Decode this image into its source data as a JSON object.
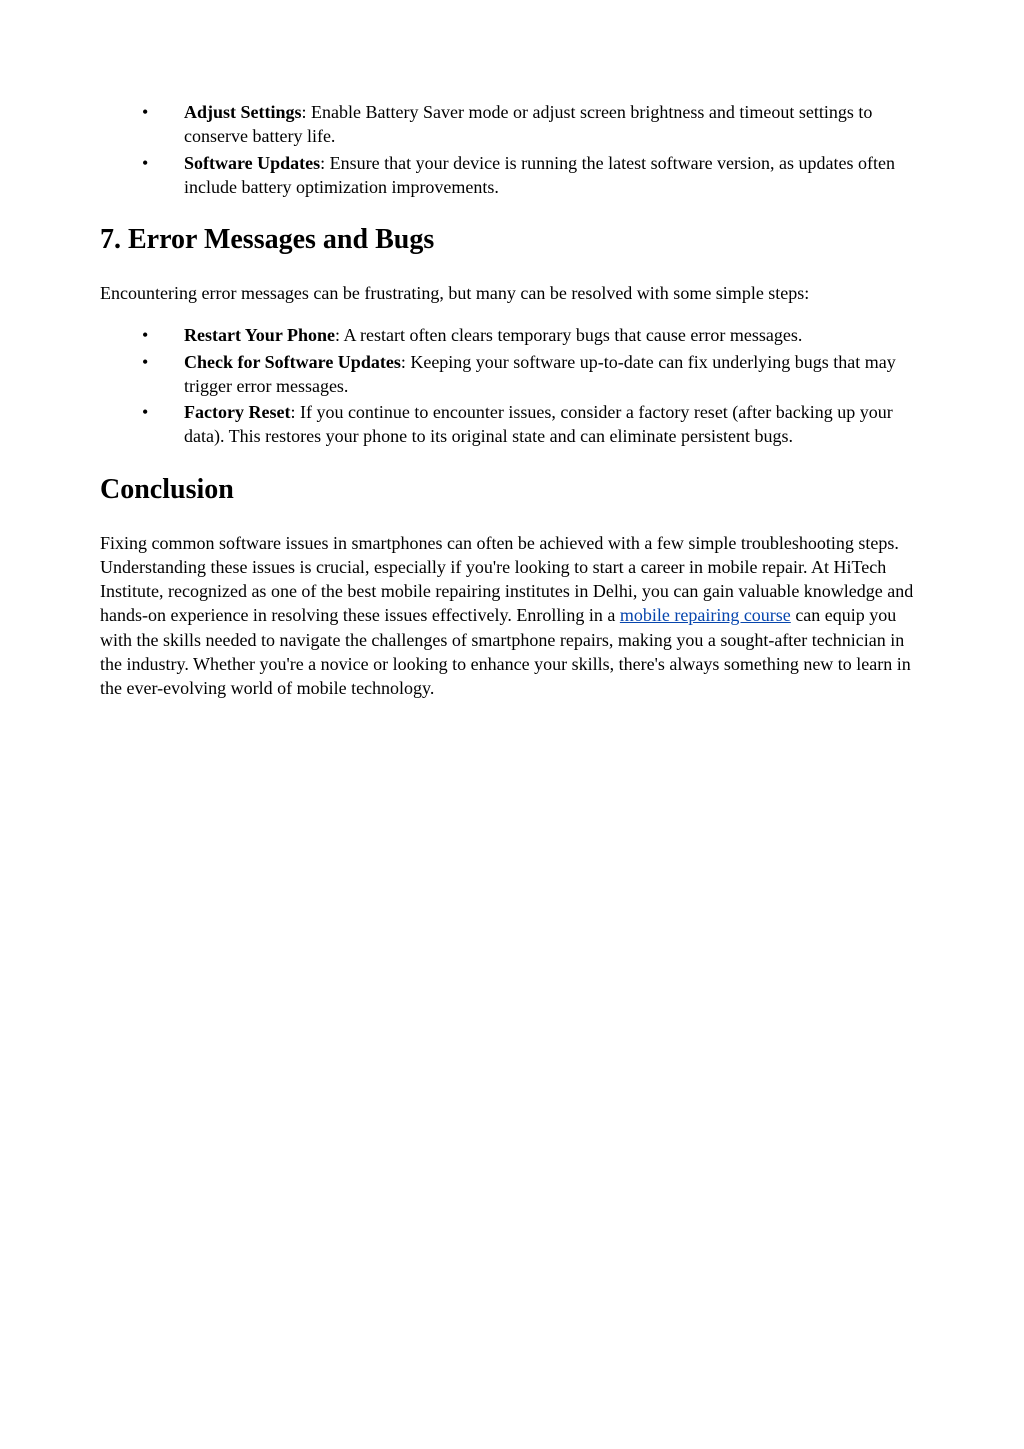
{
  "list1": {
    "items": [
      {
        "bold": "Adjust Settings",
        "text": ": Enable Battery Saver mode or adjust screen brightness and timeout settings to conserve battery life."
      },
      {
        "bold": "Software Updates",
        "text": ": Ensure that your device is running the latest software version, as updates often include battery optimization improvements."
      }
    ]
  },
  "section7": {
    "heading": "7. Error Messages and Bugs",
    "intro": "Encountering error messages can be frustrating, but many can be resolved with some simple steps:",
    "items": [
      {
        "bold": "Restart Your Phone",
        "text": ": A restart often clears temporary bugs that cause error messages."
      },
      {
        "bold": "Check for Software Updates",
        "text": ": Keeping your software up-to-date can fix underlying bugs that may trigger error messages."
      },
      {
        "bold": "Factory Reset",
        "text": ": If you continue to encounter issues, consider a factory reset (after backing up your data). This restores your phone to its original state and can eliminate persistent bugs."
      }
    ]
  },
  "conclusion": {
    "heading": "Conclusion",
    "para_before_link": "Fixing common software issues in smartphones can often be achieved with a few simple troubleshooting steps. Understanding these issues is crucial, especially if you're looking to start a career in mobile repair. At HiTech Institute, recognized as one of the best mobile repairing institutes in Delhi, you can gain valuable knowledge and hands-on experience in resolving these issues effectively. Enrolling in a ",
    "link_text": "mobile repairing course",
    "para_after_link": " can equip you with the skills needed to navigate the challenges of smartphone repairs, making you a sought-after technician in the industry. Whether you're a novice or looking to enhance your skills, there's always something new to learn in the ever-evolving world of mobile technology."
  }
}
